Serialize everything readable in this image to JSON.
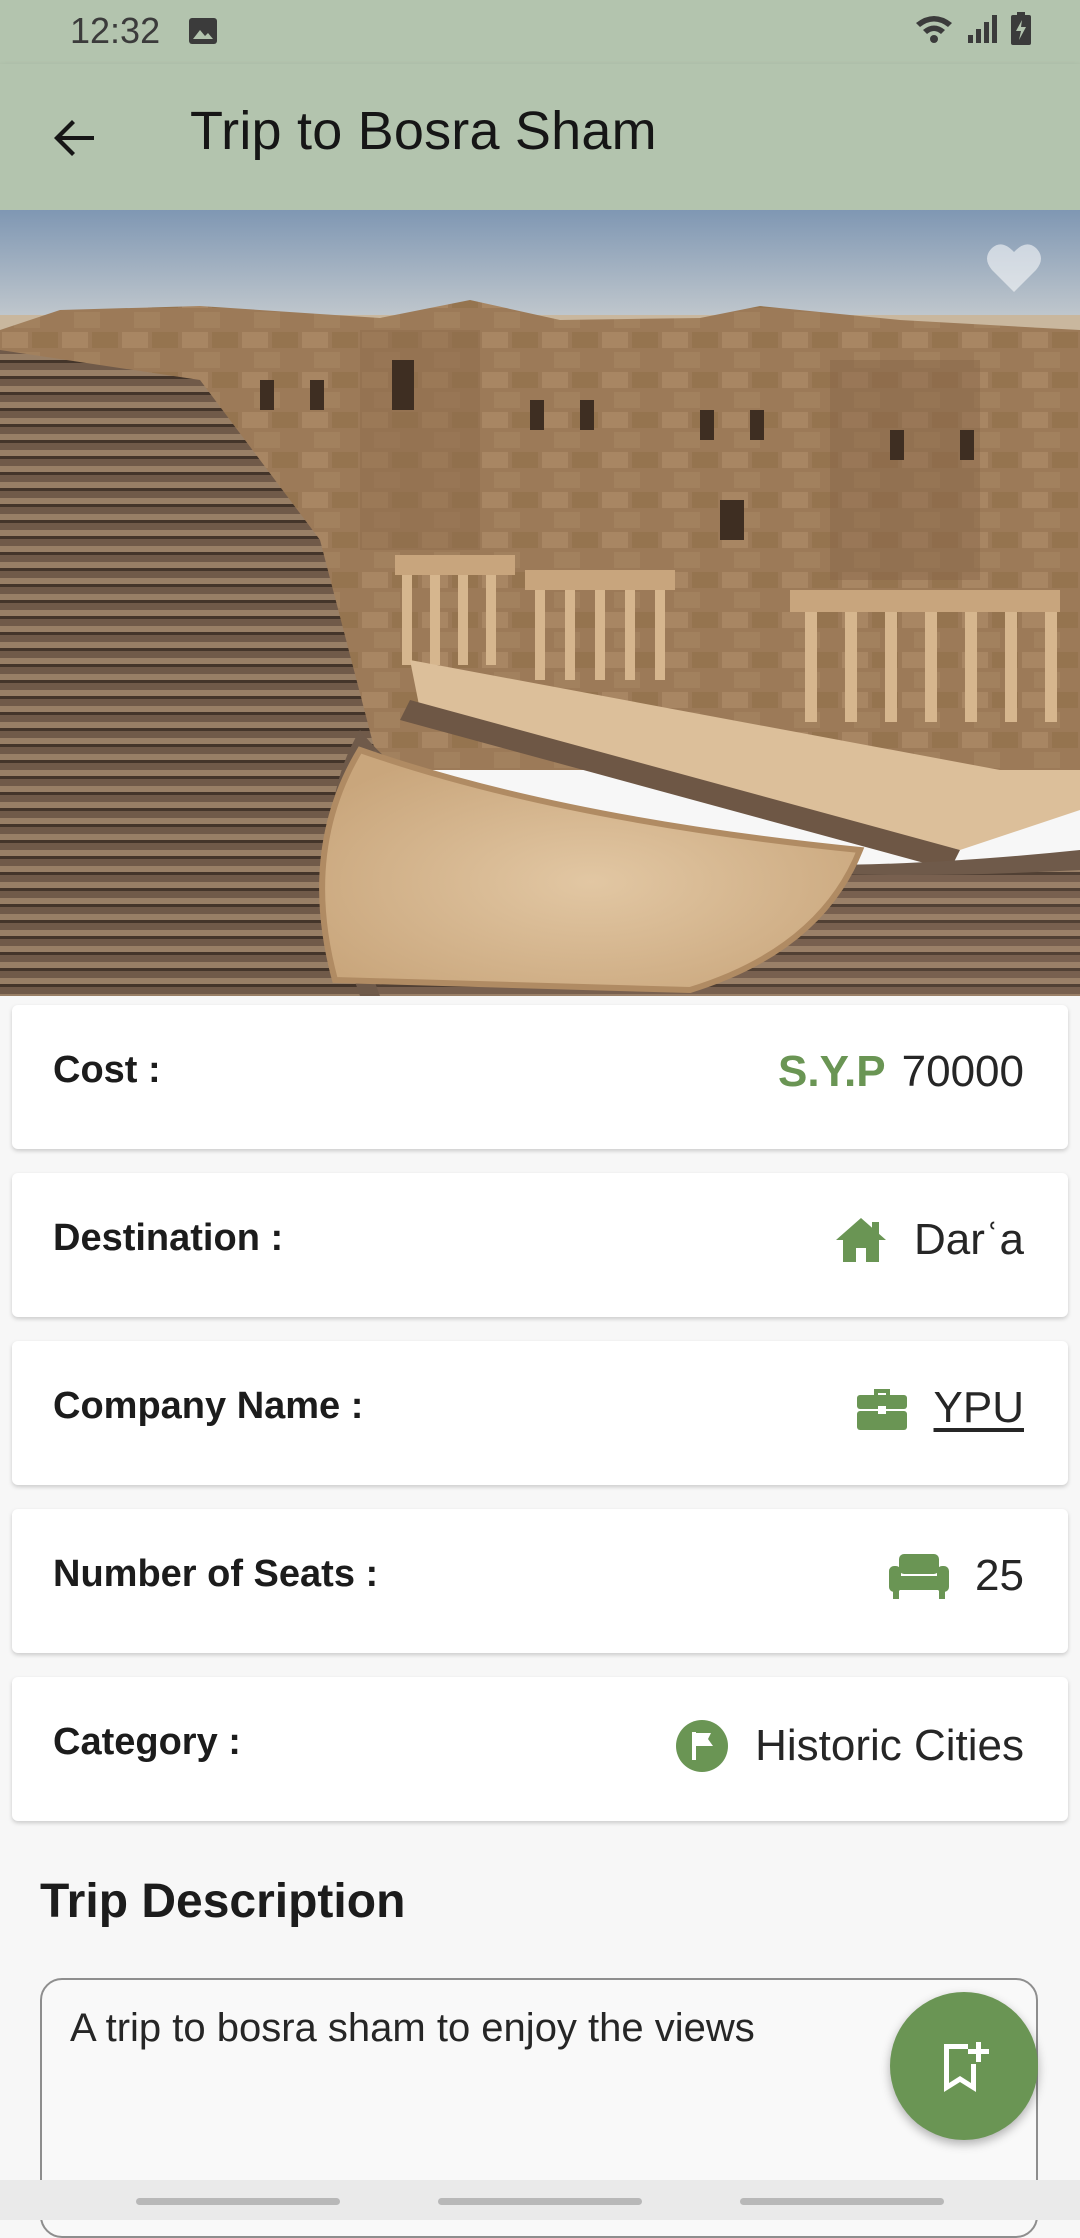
{
  "status_bar": {
    "time": "12:32",
    "icons": [
      "image-icon",
      "wifi-icon",
      "signal-icon",
      "battery-charging-icon"
    ]
  },
  "app_bar": {
    "title": "Trip to Bosra Sham",
    "back_icon": "arrow-back-icon"
  },
  "hero": {
    "favorite_icon": "heart-icon",
    "favorited": false
  },
  "details": {
    "cost": {
      "label": "Cost :",
      "currency": "S.Y.P",
      "value": "70000"
    },
    "destination": {
      "label": "Destination :",
      "icon": "home-icon",
      "value": "Darʿa"
    },
    "company": {
      "label": "Company Name :",
      "icon": "briefcase-icon",
      "value": "YPU"
    },
    "seats": {
      "label": "Number of Seats :",
      "icon": "seat-icon",
      "value": "25"
    },
    "category": {
      "label": "Category :",
      "icon": "flag-circle-icon",
      "value": "Historic Cities"
    }
  },
  "description": {
    "title": "Trip Description",
    "text": "A trip to bosra sham to enjoy the views"
  },
  "fab": {
    "icon": "bookmark-add-icon"
  },
  "colors": {
    "app_bar": "#b3c4ae",
    "accent": "#6a9554",
    "background": "#f7f7f7"
  }
}
